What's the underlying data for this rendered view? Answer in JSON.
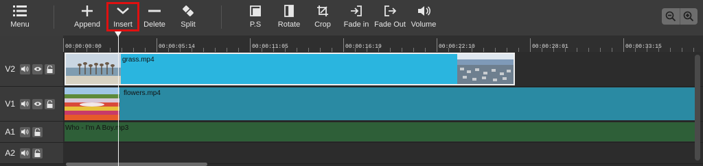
{
  "toolbar": {
    "menu": "Menu",
    "append": "Append",
    "insert": "Insert",
    "delete": "Delete",
    "split": "Split",
    "ps": "P.S",
    "rotate": "Rotate",
    "crop": "Crop",
    "fade_in": "Fade in",
    "fade_out": "Fade Out",
    "volume": "Volume",
    "highlight_color": "#e01010"
  },
  "ruler": {
    "ticks": [
      "00:00:00:00",
      "00:00:05:14",
      "00:00:11:05",
      "00:00:16:19",
      "00:00:22:10",
      "00:00:28:01",
      "00:00:33:15"
    ]
  },
  "tracks": [
    {
      "name": "V2",
      "clip": "grass.mp4",
      "color": "#2ab5df"
    },
    {
      "name": "V1",
      "clip": "flowers.mp4",
      "color": "#2a8aa3"
    },
    {
      "name": "A1",
      "clip": "Who - I'm A Boy.mp3",
      "color": "#2e5f38"
    },
    {
      "name": "A2",
      "clip": ""
    }
  ],
  "icons": [
    "menu-icon",
    "plus-icon",
    "chevron-down-icon",
    "minus-icon",
    "split-icon",
    "ps-icon",
    "rotate-icon",
    "crop-icon",
    "fade-in-icon",
    "fade-out-icon",
    "volume-icon",
    "zoom-out-icon",
    "zoom-in-icon",
    "speaker-icon",
    "eye-icon",
    "lock-icon"
  ]
}
